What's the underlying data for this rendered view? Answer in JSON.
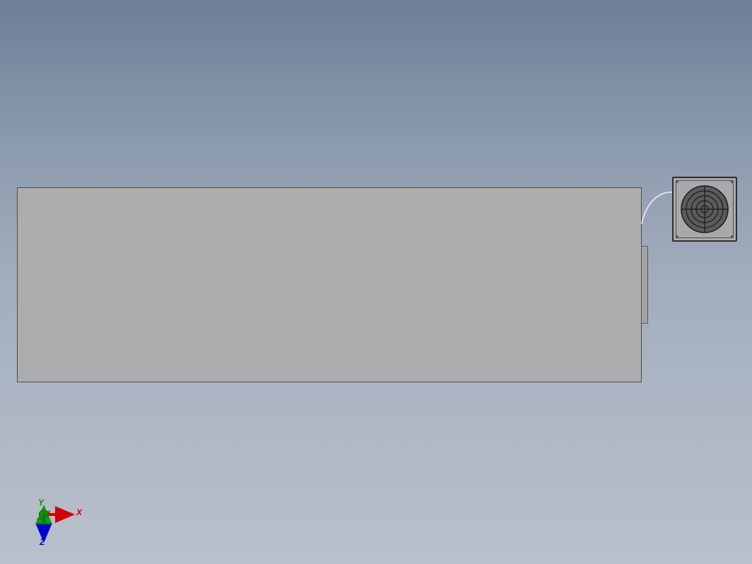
{
  "triad": {
    "x_label": "X",
    "y_label": "Y",
    "z_label": "Z"
  },
  "colors": {
    "axis_x": "#D00000",
    "axis_y": "#009000",
    "axis_z": "#0000D0",
    "panel_fill": "#ACACAC",
    "bg_top": "#6E7E94",
    "bg_bottom": "#B8C0CB"
  },
  "icons": {
    "fan": "fan-grill-icon",
    "triad": "orientation-triad-icon"
  }
}
